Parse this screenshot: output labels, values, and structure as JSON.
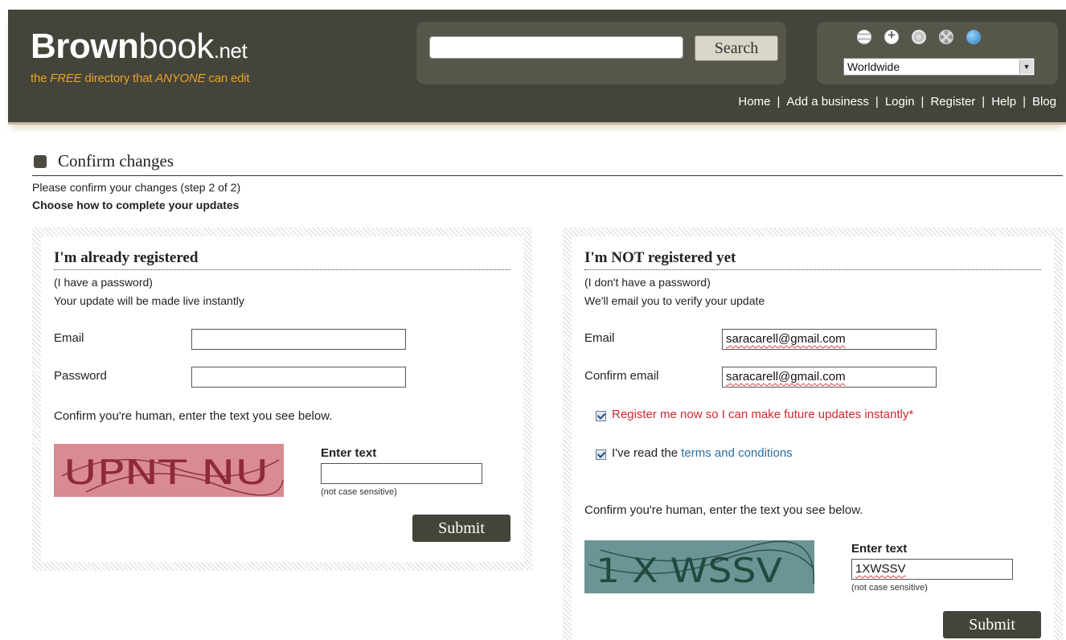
{
  "header": {
    "logo_bold": "Brown",
    "logo_thin": "book",
    "logo_tld": ".net",
    "tagline_1": "the ",
    "tagline_free": "FREE",
    "tagline_2": " directory that ",
    "tagline_anyone": "ANYONE",
    "tagline_3": " can edit",
    "search_placeholder": "",
    "search_label": "Search",
    "region_selected": "Worldwide",
    "flag_icons": [
      "us-flag-icon",
      "switzerland-flag-icon",
      "india-flag-icon",
      "uk-flag-icon",
      "globe-icon"
    ],
    "nav": [
      "Home",
      "Add a business",
      "Login",
      "Register",
      "Help",
      "Blog"
    ],
    "nav_separator": "|"
  },
  "page": {
    "title": "Confirm changes",
    "instruction": "Please confirm your changes (step 2 of 2)",
    "subheading": "Choose how to complete your updates"
  },
  "registered": {
    "heading": "I'm already registered",
    "line1": "(I have a password)",
    "line2": "Your update will be made live instantly",
    "email_label": "Email",
    "email_value": "",
    "password_label": "Password",
    "password_value": "",
    "captcha_prompt": "Confirm you're human, enter the text you see below.",
    "captcha_text": "UPNT NU",
    "enter_text_label": "Enter text",
    "enter_text_value": "",
    "hint": "(not case sensitive)",
    "submit_label": "Submit"
  },
  "not_registered": {
    "heading": "I'm NOT registered yet",
    "line1": "(I don't have a password)",
    "line2": "We'll email you to verify your update",
    "email_label": "Email",
    "email_value": "saracarell@gmail.com",
    "confirm_email_label": "Confirm email",
    "confirm_email_value": "saracarell@gmail.com",
    "register_checkbox_label": "Register me now so I can make future updates instantly*",
    "register_checked": true,
    "terms_prefix": "I've read the ",
    "terms_link": "terms and conditions",
    "terms_checked": true,
    "captcha_prompt": "Confirm you're human, enter the text you see below.",
    "captcha_text": "1 X WSSV",
    "enter_text_label": "Enter text",
    "enter_text_value": "1XWSSV",
    "hint": "(not case sensitive)",
    "submit_label": "Submit"
  },
  "colors": {
    "header_bg": "#45443a",
    "tagline": "#e8a326",
    "captcha_left_bg": "#d98a93",
    "captcha_right_bg": "#6b9494",
    "red_text": "#d0282f",
    "link": "#2a6da4"
  }
}
